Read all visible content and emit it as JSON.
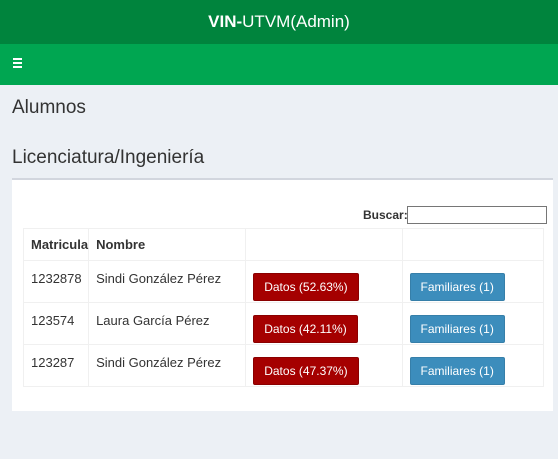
{
  "header": {
    "title_bold": "VIN-",
    "title_rest": "UTVM(Admin)"
  },
  "page": {
    "heading": "Alumnos",
    "subheading": "Licenciatura/Ingeniería"
  },
  "search": {
    "label": "Buscar:",
    "value": ""
  },
  "table": {
    "columns": [
      "Matricula",
      "Nombre",
      "",
      ""
    ],
    "rows": [
      {
        "matricula": "1232878",
        "nombre": "Sindi González Pérez",
        "datos": "Datos (52.63%)",
        "familiares": "Familiares (1)"
      },
      {
        "matricula": "123574",
        "nombre": "Laura García Pérez",
        "datos": "Datos (42.11%)",
        "familiares": "Familiares (1)"
      },
      {
        "matricula": "123287",
        "nombre": "Sindi González Pérez",
        "datos": "Datos (47.37%)",
        "familiares": "Familiares (1)"
      }
    ]
  },
  "colors": {
    "topbar": "#00843d",
    "navbar": "#00a651",
    "datos_button": "#a50000",
    "familiares_button": "#3c8dbc"
  },
  "icons": {
    "menu": "hamburger-menu-icon"
  }
}
